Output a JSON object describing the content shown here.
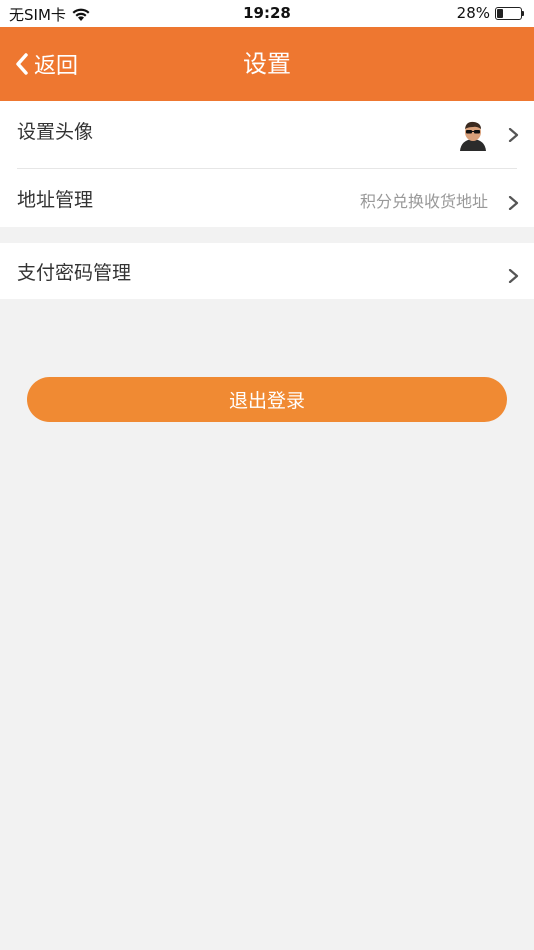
{
  "status_bar": {
    "carrier": "无SIM卡",
    "time": "19:28",
    "battery": "28%",
    "battery_level": 0.28,
    "icons": [
      "wifi-icon",
      "battery-icon"
    ]
  },
  "nav": {
    "back_label": "返回",
    "title": "设置",
    "icons": [
      "chevron-left-icon"
    ]
  },
  "settings": {
    "avatar_row": {
      "label": "设置头像"
    },
    "address_row": {
      "label": "地址管理",
      "value": "积分兑换收货地址"
    },
    "password_row": {
      "label": "支付密码管理"
    }
  },
  "logout_label": "退出登录",
  "colors": {
    "nav_bg": "#ee7730",
    "button_bg": "#f08a33",
    "page_bg": "#f2f2f2"
  }
}
